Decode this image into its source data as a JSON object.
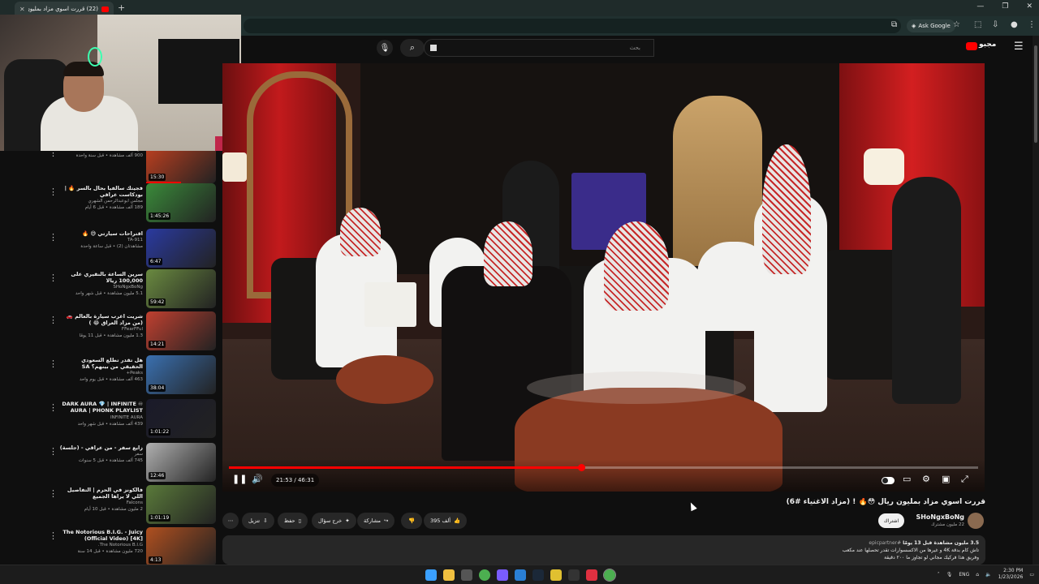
{
  "browser": {
    "tab_title": "(22) قررت اسوي مزاد بمليون...",
    "ask_google": "Ask Google",
    "search_placeholder": "بحث"
  },
  "header": {
    "logo_text": "مجبو"
  },
  "sidebar": {
    "items": [
      {
        "title": "",
        "channel": "الزعل",
        "stats": "900 ألف مشاهدة • قبل سنة واحدة",
        "duration": "15:30",
        "progress": 0.5
      },
      {
        "title": "فجيتك سالفيا بحال بالسر 🔥 | بودكاست عراقي",
        "channel": "مجلس ابوعبدالرحمن الشهري",
        "stats": "189 ألف مشاهدة • قبل 6 أيام",
        "duration": "1:45:26",
        "progress": 0
      },
      {
        "title": "اقتراحات سيارتي 😅 🔥",
        "channel": "TA-911",
        "stats": "مشاهدتان (2) • قبل ساعة واحدة",
        "duration": "6:47",
        "progress": 0
      },
      {
        "title": "سرين الساعة بالنقيري على 100,000 ريالا",
        "channel": "SHoNgxBoNg",
        "stats": "5.1 مليون مشاهدة • قبل شهر واحد",
        "duration": "59:42",
        "progress": 0
      },
      {
        "title": "شريت اغرب سيارة بالعالم 🚗 (من مزاد العراق 😂 )",
        "channel": "FFearFFul",
        "stats": "1.3 مليون مشاهدة • قبل 11 يومًا",
        "duration": "14:21",
        "progress": 0
      },
      {
        "title": "هل تقدر تطلع السعودي الحقيقي من بينهم؟ SA",
        "channel": "Peaks+",
        "stats": "463 ألف مشاهدة • قبل يوم واحد",
        "duration": "38:04",
        "progress": 0
      },
      {
        "title": "DARK AURA 💎 | INFINITE ♾ AURA | PHONK PLAYLIST FOR",
        "channel": "INFINITE AURA",
        "stats": "439 ألف مشاهدة • قبل شهر واحد",
        "duration": "1:01:22",
        "progress": 0
      },
      {
        "title": "زايع سفر - من عراقي - (جلسة)",
        "channel": "سفر",
        "stats": "745 ألف مشاهدة • قبل 5 سنوات",
        "duration": "12:46",
        "progress": 0
      },
      {
        "title": "فالكونز في الحرم | التفاصيل اللي لا يراها الجميع",
        "channel": "Falcons",
        "stats": "2 مليون مشاهدة • قبل 10 أيام",
        "duration": "1:01:19",
        "progress": 0
      },
      {
        "title": "The Notorious B.I.G. - Juicy (Official Video) [4K]",
        "channel": "The Notorious B.I.G.",
        "stats": "720 مليون مشاهدة • قبل 14 سنة",
        "duration": "4:13",
        "progress": 0
      }
    ]
  },
  "player": {
    "time": "21:53 / 46:31",
    "progress": 0.47
  },
  "video": {
    "title": "قررت اسوي مزاد بمليون ريال 😳🔥 ! (مزاد الاغنياء #6)",
    "channel_name": "SHoNgxBoNg",
    "channel_subs": "22 مليون مشترك",
    "subscribe": "اشتراك",
    "likes": "395 ألف",
    "share": "مشاركة",
    "remix": "خرج سؤال",
    "save": "حفظ",
    "download": "تنزيل",
    "desc_stats": "3.5 مليون مشاهدة  قبل 13 يومًا",
    "desc_tag": "#epicpartner",
    "desc_line1": "تاش كام بدقة 4K و غيرها من الاكسسوارات تقدر تحصلها عند مكعب",
    "desc_line2": "وفريق هذا فركيك مجاني لو تجاوز ما ٢٠٠ دقيقة"
  },
  "taskbar": {
    "lang": "ENG",
    "time": "2:30 PM",
    "date": "1/23/2026"
  }
}
